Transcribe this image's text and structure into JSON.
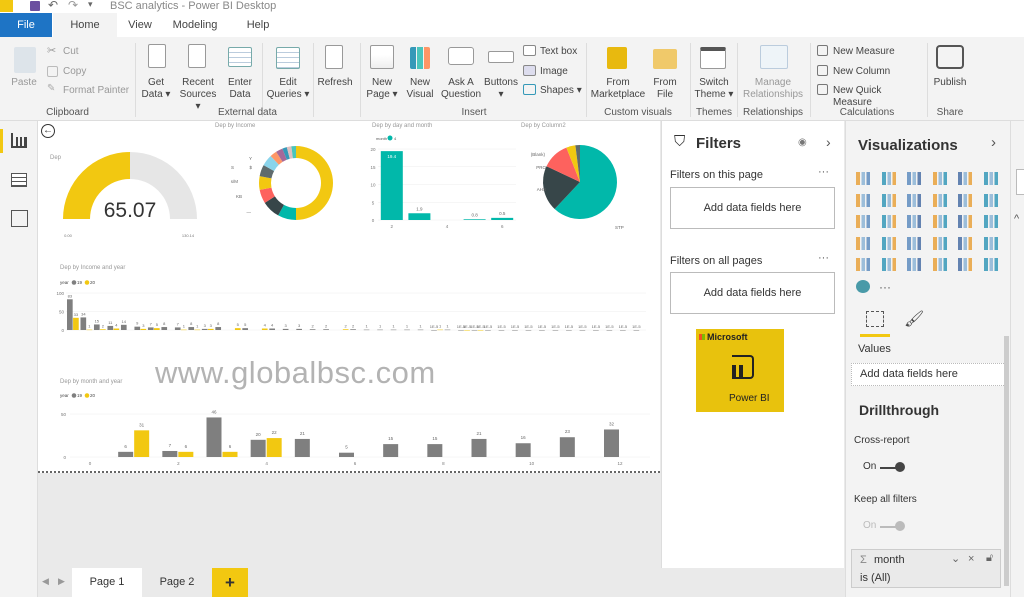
{
  "window": {
    "title": "BSC analytics - Power BI Desktop"
  },
  "menu_tabs": [
    {
      "label": "File"
    },
    {
      "label": "Home"
    },
    {
      "label": "View"
    },
    {
      "label": "Modeling"
    },
    {
      "label": "Help"
    }
  ],
  "ribbon": {
    "clipboard": {
      "paste": "Paste",
      "cut": "Cut",
      "copy": "Copy",
      "format_painter": "Format Painter",
      "group": "Clipboard"
    },
    "external": {
      "get_data": [
        "Get",
        "Data ▾"
      ],
      "recent": [
        "Recent",
        "Sources ▾"
      ],
      "enter": [
        "Enter",
        "Data"
      ],
      "edit": [
        "Edit",
        "Queries ▾"
      ],
      "refresh": "Refresh",
      "group": "External data"
    },
    "insert": {
      "new_page": [
        "New",
        "Page ▾"
      ],
      "new_visual": [
        "New",
        "Visual"
      ],
      "ask": [
        "Ask A",
        "Question"
      ],
      "buttons": [
        "Buttons",
        "▾"
      ],
      "text_box": "Text box",
      "image": "Image",
      "shapes": "Shapes ▾",
      "group": "Insert"
    },
    "custom": {
      "marketplace": [
        "From",
        "Marketplace"
      ],
      "file": [
        "From",
        "File"
      ],
      "group": "Custom visuals"
    },
    "themes": {
      "switch": [
        "Switch",
        "Theme ▾"
      ],
      "group": "Themes"
    },
    "relationships": {
      "manage": [
        "Manage",
        "Relationships"
      ],
      "group": "Relationships"
    },
    "calculations": {
      "new_measure": "New Measure",
      "new_column": "New Column",
      "new_quick": "New Quick Measure",
      "group": "Calculations"
    },
    "share": {
      "publish": "Publish",
      "group": "Share"
    }
  },
  "colors": {
    "accent": "#f2c811",
    "teal": "#01b8aa",
    "gray": "#7f7f7f",
    "file_tab": "#1e74c5"
  },
  "charts": {
    "gauge": {
      "title": "Dep",
      "value": "65.07",
      "min": "0.00",
      "max": "130.14"
    },
    "donut": {
      "title": "Dep by Income",
      "labels": [
        "Y",
        "S",
        "$",
        "s/M",
        "KB",
        "—"
      ]
    },
    "day": {
      "title": "Dep by day and month",
      "legend_title": "month",
      "legend_item": "4"
    },
    "pie": {
      "title": "Dep by Column2",
      "labels": [
        "(Blank)",
        "PRO",
        "AHS",
        "STP"
      ]
    },
    "income": {
      "title": "Dep by Income and year",
      "legend_title": "year",
      "legend": [
        "19",
        "20"
      ]
    },
    "month": {
      "title": "Dep by month and year",
      "legend_title": "year",
      "legend": [
        "19",
        "20"
      ]
    }
  },
  "chart_data": [
    {
      "type": "gauge",
      "title": "Dep",
      "value": 65.07,
      "min": 0,
      "max": 130.14
    },
    {
      "type": "pie",
      "title": "Dep by Income",
      "donut": true,
      "values": [
        50,
        8,
        8,
        6,
        6,
        5,
        5,
        3,
        3,
        2,
        2,
        2
      ],
      "colors": [
        "#f2c811",
        "#01b8aa",
        "#374649",
        "#fd625e",
        "#f2c811",
        "#5f6b6d",
        "#8ad4eb",
        "#fe9666",
        "#a66999",
        "#3599b8",
        "#dfbfbf",
        "#4ac5bb"
      ]
    },
    {
      "type": "bar",
      "title": "Dep by day and month",
      "x": [
        2,
        3,
        5,
        6
      ],
      "values": [
        19.4,
        1.9,
        0.2,
        0.6
      ],
      "labels": [
        "19.4",
        "1.9",
        "0.8",
        "0.5"
      ],
      "xticks": [
        2,
        4,
        6
      ],
      "yticks": [
        0,
        5,
        10,
        15,
        20
      ],
      "ylim": [
        0,
        20
      ],
      "series_name": "4",
      "color": "#01b8aa"
    },
    {
      "type": "pie",
      "title": "Dep by Column2",
      "categories": [
        "STP",
        "AHS",
        "PRO",
        "(Blank)",
        "other"
      ],
      "values": [
        62,
        20,
        12,
        4,
        2
      ],
      "colors": [
        "#01b8aa",
        "#374649",
        "#fd625e",
        "#f2c811",
        "#5f6b6d"
      ]
    },
    {
      "type": "bar",
      "title": "Dep by Income and year",
      "yticks": [
        0,
        50,
        100
      ],
      "ylim": [
        0,
        100
      ],
      "series": [
        {
          "name": "19",
          "values": [
            83,
            34,
            15,
            11,
            14,
            9,
            7,
            8,
            7,
            8,
            3,
            8,
            null,
            5,
            null,
            4,
            3,
            3,
            2,
            2,
            null,
            2,
            1,
            1,
            1,
            1,
            1,
            0,
            1,
            0,
            0,
            0,
            0,
            0,
            0,
            0,
            0,
            0,
            0,
            0,
            0,
            0,
            1e-05
          ]
        },
        {
          "name": "20",
          "values": [
            33,
            1,
            2,
            4,
            null,
            3,
            5,
            null,
            1,
            1,
            3,
            null,
            5,
            null,
            4,
            null,
            null,
            null,
            null,
            null,
            2,
            null,
            null,
            null,
            null,
            null,
            null,
            1,
            null,
            0,
            0,
            null,
            null,
            null,
            null,
            null,
            null,
            null,
            null,
            null,
            null,
            null,
            null
          ]
        }
      ]
    },
    {
      "type": "bar",
      "title": "Dep by month and year",
      "x": [
        1,
        2,
        3,
        4,
        5,
        6,
        7,
        8,
        9,
        10,
        11,
        12
      ],
      "xticks": [
        0,
        2,
        4,
        6,
        8,
        10,
        12
      ],
      "yticks": [
        0,
        50
      ],
      "ylim": [
        0,
        50
      ],
      "series": [
        {
          "name": "19",
          "values": [
            6,
            7,
            46,
            20,
            21,
            5,
            15,
            15,
            21,
            16,
            23,
            32
          ]
        },
        {
          "name": "20",
          "values": [
            31,
            6,
            6,
            22,
            null,
            null,
            null,
            null,
            null,
            null,
            null,
            null
          ]
        }
      ]
    }
  ],
  "watermark": "www.globalbsc.com",
  "pages": [
    {
      "label": "Page 1"
    },
    {
      "label": "Page 2"
    }
  ],
  "add_page": "+",
  "filters": {
    "title": "Filters",
    "this_page": "Filters on this page",
    "all_pages": "Filters on all pages",
    "add": "Add data fields here",
    "more": "···"
  },
  "logo": {
    "brand": "Microsoft",
    "product": "Power BI"
  },
  "viz": {
    "title": "Visualizations",
    "more": "···",
    "values": "Values",
    "add": "Add data fields here",
    "drillthrough": "Drillthrough",
    "cross_report": "Cross-report",
    "on": "On",
    "keep_all": "Keep all filters",
    "filter_field": "month",
    "filter_sigma": "Σ",
    "filter_state": "is (All)"
  }
}
